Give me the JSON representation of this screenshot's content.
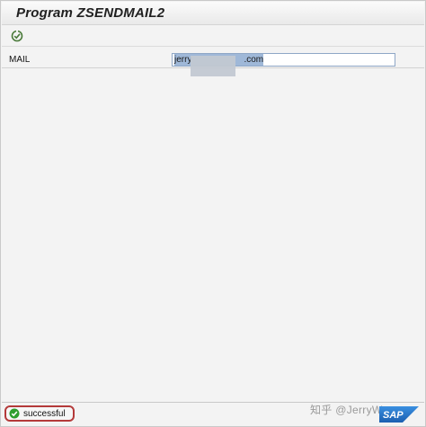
{
  "window": {
    "title": "Program ZSENDMAIL2"
  },
  "toolbar": {
    "execute_icon": "execute-icon"
  },
  "selection": {
    "mail_label": "MAIL",
    "mail_value": "jerry.com",
    "mail_value_prefix": "jerry",
    "mail_value_suffix": ".com"
  },
  "status": {
    "message": "successful",
    "icon": "check-circle-icon",
    "icon_color": "#2e9e2e"
  },
  "watermark": {
    "text": "知乎 @JerryWang",
    "logo": "SAP"
  },
  "colors": {
    "status_highlight": "#b43a3a",
    "input_selection": "#9fb8d8",
    "sap_blue": "#1b6fc6"
  }
}
